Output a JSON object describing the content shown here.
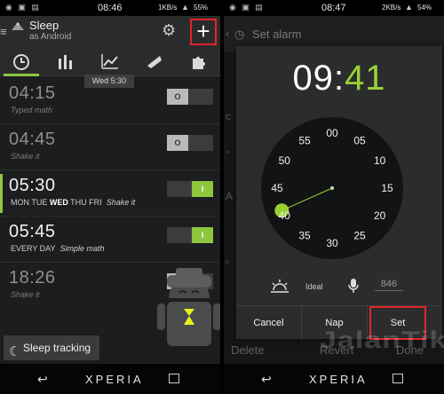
{
  "left": {
    "status": {
      "time": "08:46",
      "speed": "1KB/s",
      "battery": "55%"
    },
    "app": {
      "title": "Sleep",
      "subtitle": "as Android",
      "add_label": "+"
    },
    "tooltip": "Wed 5:30",
    "alarms": [
      {
        "time": "04:15",
        "days": "",
        "task": "Typed math",
        "enabled": false,
        "toggle_label": "O"
      },
      {
        "time": "04:45",
        "days": "",
        "task": "Shake it",
        "enabled": false,
        "toggle_label": "O"
      },
      {
        "time": "05:30",
        "days_pre": "MON TUE ",
        "days_today": "WED",
        "days_post": " THU FRI",
        "task": "Shake it",
        "enabled": true,
        "toggle_label": "I"
      },
      {
        "time": "05:45",
        "days": "EVERY DAY",
        "task": "Simple math",
        "enabled": true,
        "toggle_label": "I"
      },
      {
        "time": "18:26",
        "days": "",
        "task": "Shake it",
        "enabled": false,
        "toggle_label": "O"
      }
    ],
    "sleep_tracking": "Sleep tracking",
    "brand": "XPERIA",
    "accent": "#8dc63f"
  },
  "right": {
    "status": {
      "time": "08:47",
      "speed": "2KB/s",
      "battery": "54%"
    },
    "bg_title": "Set alarm",
    "picker": {
      "hours": "09",
      "separator": ":",
      "minutes": "41",
      "dial": [
        "00",
        "05",
        "10",
        "15",
        "20",
        "25",
        "30",
        "35",
        "40",
        "45",
        "50",
        "55"
      ],
      "selected_minute": 41
    },
    "ideal_label": "Ideal",
    "noise_value": "846",
    "buttons": {
      "cancel": "Cancel",
      "nap": "Nap",
      "set": "Set"
    },
    "under": {
      "delete": "Delete",
      "revert": "Revert",
      "done": "Done"
    },
    "watermark": "JalanTikus",
    "brand": "XPERIA",
    "highlight": "#e0262b"
  }
}
